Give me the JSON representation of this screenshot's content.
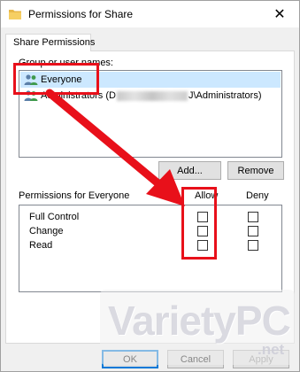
{
  "window": {
    "title": "Permissions for Share",
    "icon": "folder-icon",
    "close_glyph": "✕"
  },
  "tabs": [
    {
      "label": "Share Permissions",
      "selected": true
    }
  ],
  "group_section": {
    "label": "Group or user names:",
    "items": [
      {
        "name": "Everyone",
        "icon": "users-icon",
        "selected": true
      },
      {
        "name_prefix": "Administrators (D",
        "name_suffix": "J\\Administrators)",
        "icon": "users-icon",
        "selected": false
      }
    ],
    "add_label": "Add...",
    "remove_label": "Remove"
  },
  "permissions_section": {
    "label": "Permissions for Everyone",
    "allow_header": "Allow",
    "deny_header": "Deny",
    "rows": [
      {
        "name": "Full Control",
        "allow": false,
        "deny": false
      },
      {
        "name": "Change",
        "allow": false,
        "deny": false
      },
      {
        "name": "Read",
        "allow": false,
        "deny": false
      }
    ]
  },
  "footer": {
    "ok_label": "OK",
    "cancel_label": "Cancel",
    "apply_label": "Apply"
  },
  "annotations": {
    "highlight_color": "#e8101a",
    "watermark_text": "VarietyPC",
    "watermark_suffix": ".net"
  },
  "colors": {
    "selection": "#cce8ff",
    "default_button_border": "#0078d7"
  }
}
